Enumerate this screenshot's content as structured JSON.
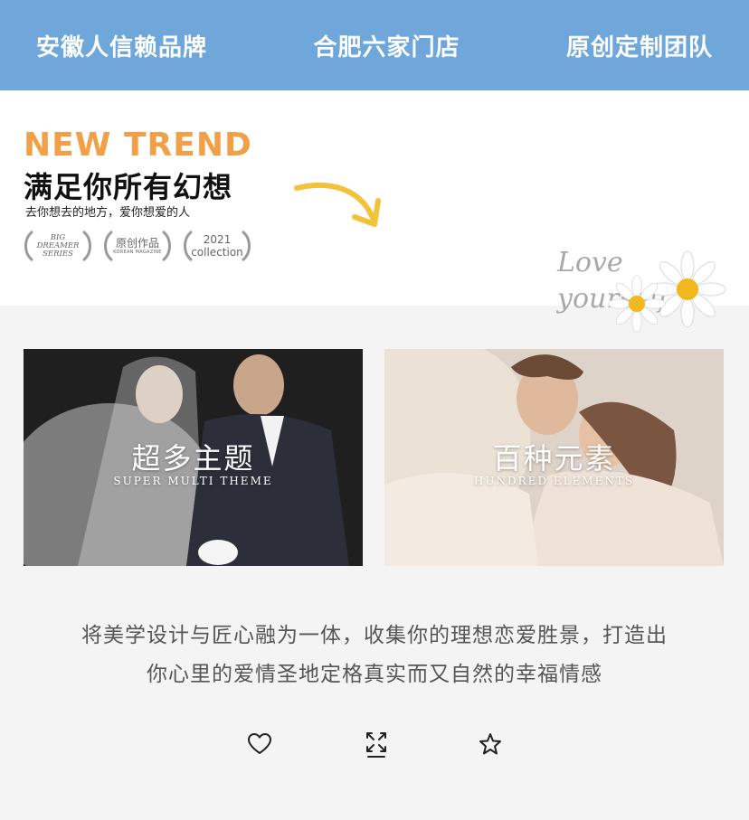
{
  "topbar": {
    "items": [
      "安徽人信赖品牌",
      "合肥六家门店",
      "原创定制团队"
    ]
  },
  "promo": {
    "title_en": "NEW TREND",
    "headline": "满足你所有幻想",
    "subline": "去你想去的地方，爱你想爱的人",
    "badges": [
      {
        "line1": "BIG",
        "line2": "DREAMER",
        "line3": "SERIES"
      },
      {
        "main": "原创作品",
        "small": "KOREAN MAGAZINE"
      },
      {
        "year": "2021",
        "word": "collection"
      }
    ],
    "love_text_line1": "Love",
    "love_text_line2": "yourself"
  },
  "cards": [
    {
      "title": "超多主题",
      "subtitle": "SUPER MULTI THEME"
    },
    {
      "title": "百种元素",
      "subtitle": "HUNDRED ELEMENTS"
    }
  ],
  "description": {
    "line1": "将美学设计与匠心融为一体，收集你的理想恋爱胜景，打造出",
    "line2": "你心里的爱情圣地定格真实而又自然的幸福情感"
  },
  "icons": {
    "like": "heart-icon",
    "expand": "expand-icon",
    "favorite": "star-icon"
  },
  "colors": {
    "topbar": "#6fa7da",
    "accent_orange": "#f1a048",
    "text": "#555555"
  }
}
